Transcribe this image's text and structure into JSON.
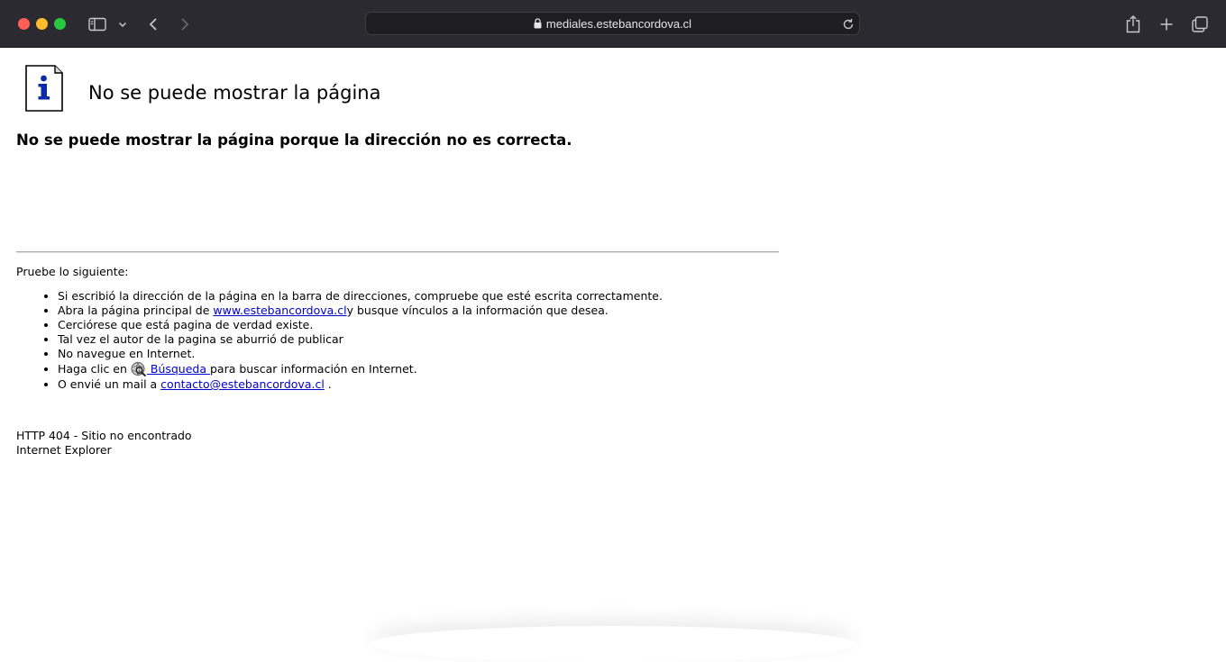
{
  "browser": {
    "url": "mediales.estebancordova.cl",
    "colors": {
      "chrome_bg": "#2b2a30",
      "close": "#ff5f57",
      "minimize": "#febc2e",
      "maximize": "#28c840"
    }
  },
  "page": {
    "title": "No se puede mostrar la página",
    "subtitle": "No se puede mostrar la página porque la dirección no es correcta.",
    "try_label": "Pruebe lo siguiente:",
    "tips": {
      "t1": "Si escribió la dirección de la página en la barra de direcciones, compruebe que esté escrita correctamente.",
      "t2_before": "Abra la página principal de ",
      "t2_link": "www.estebancordova.cl",
      "t2_after": "y busque vínculos a la información que desea.",
      "t3": "Cerciórese que está pagina de verdad existe.",
      "t4": "Tal vez el autor de la pagina se aburrió de publicar",
      "t5": "No navegue en Internet.",
      "t6_before": "Haga clic en ",
      "t6_link": " Búsqueda ",
      "t6_after": "para buscar información en Internet.",
      "t7_before": "O envié un mail a ",
      "t7_link": "contacto@estebancordova.cl",
      "t7_after": " ."
    },
    "footer_error": "HTTP 404 - Sitio no encontrado",
    "footer_browser": "Internet Explorer",
    "link_color": "#0000cc"
  }
}
